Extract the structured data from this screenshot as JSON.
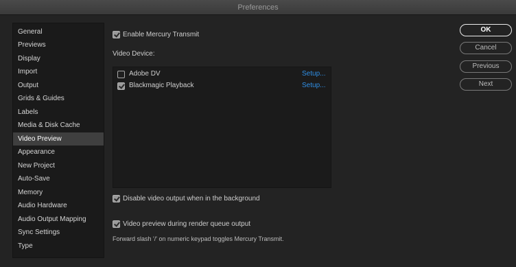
{
  "window": {
    "title": "Preferences"
  },
  "sidebar": {
    "items": [
      {
        "label": "General",
        "active": false
      },
      {
        "label": "Previews",
        "active": false
      },
      {
        "label": "Display",
        "active": false
      },
      {
        "label": "Import",
        "active": false
      },
      {
        "label": "Output",
        "active": false
      },
      {
        "label": "Grids & Guides",
        "active": false
      },
      {
        "label": "Labels",
        "active": false
      },
      {
        "label": "Media & Disk Cache",
        "active": false
      },
      {
        "label": "Video Preview",
        "active": true
      },
      {
        "label": "Appearance",
        "active": false
      },
      {
        "label": "New Project",
        "active": false
      },
      {
        "label": "Auto-Save",
        "active": false
      },
      {
        "label": "Memory",
        "active": false
      },
      {
        "label": "Audio Hardware",
        "active": false
      },
      {
        "label": "Audio Output Mapping",
        "active": false
      },
      {
        "label": "Sync Settings",
        "active": false
      },
      {
        "label": "Type",
        "active": false
      }
    ]
  },
  "main": {
    "enable_mercury": {
      "label": "Enable Mercury Transmit",
      "checked": true
    },
    "video_device_label": "Video Device:",
    "devices": [
      {
        "name": "Adobe DV",
        "checked": false,
        "setup_label": "Setup..."
      },
      {
        "name": "Blackmagic Playback",
        "checked": true,
        "setup_label": "Setup..."
      }
    ],
    "disable_background": {
      "label": "Disable video output when in the background",
      "checked": true
    },
    "render_queue": {
      "label": "Video preview during render queue output",
      "checked": true
    },
    "note": "Forward slash '/' on numeric keypad toggles Mercury Transmit."
  },
  "buttons": {
    "ok": "OK",
    "cancel": "Cancel",
    "previous": "Previous",
    "next": "Next"
  },
  "colors": {
    "accent_link": "#2f8fe6",
    "selected_item": "#3f3f3f",
    "background": "#232323"
  }
}
